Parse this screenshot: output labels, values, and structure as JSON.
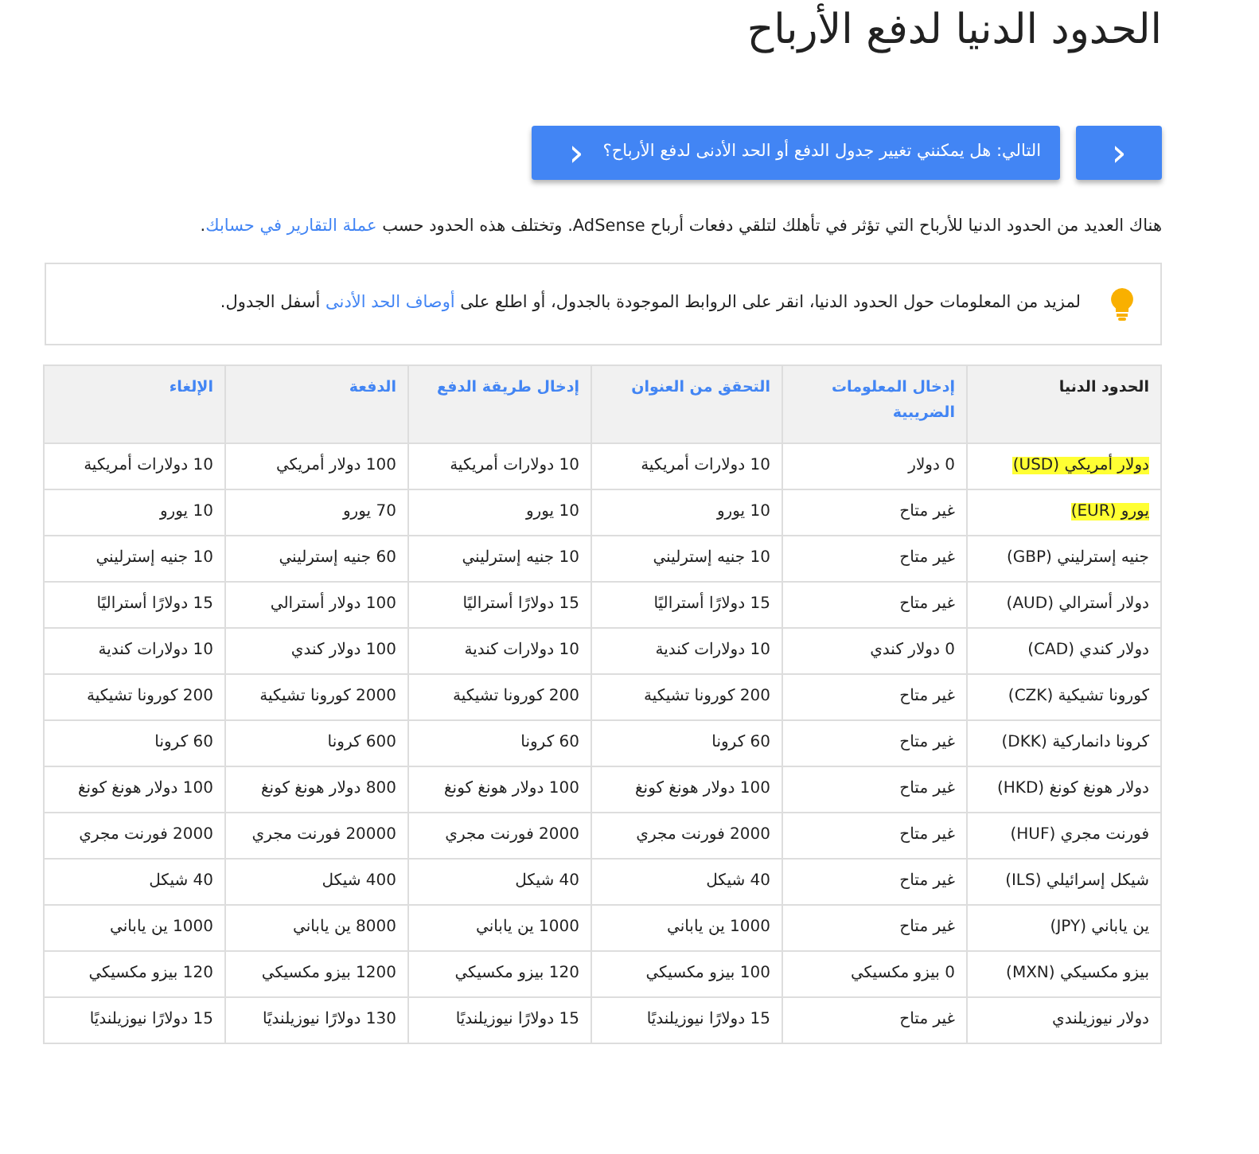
{
  "title": "الحدود الدنيا لدفع الأرباح",
  "nav": {
    "prev_icon": "‹",
    "next_label": "التالي: هل يمكنني تغيير جدول الدفع أو الحد الأدنى لدفع الأرباح؟"
  },
  "intro": [
    {
      "kind": "text",
      "text": "هناك العديد من الحدود الدنيا للأرباح التي تؤثر في تأهلك لتلقي دفعات أرباح AdSense. وتختلف هذه الحدود حسب "
    },
    {
      "kind": "link",
      "text": "عملة التقارير في حسابك"
    },
    {
      "kind": "text",
      "text": "."
    }
  ],
  "callout": [
    {
      "kind": "text",
      "text": "لمزيد من المعلومات حول الحدود الدنيا، انقر على الروابط الموجودة بالجدول، أو اطلع على "
    },
    {
      "kind": "link",
      "text": "أوصاف الحد الأدنى"
    },
    {
      "kind": "text",
      "text": " أسفل الجدول."
    }
  ],
  "table": {
    "columns": [
      {
        "label": "الحدود الدنيا",
        "kind": "plain"
      },
      {
        "label": "إدخال المعلومات الضريبية",
        "kind": "link"
      },
      {
        "label": "التحقق من العنوان",
        "kind": "link"
      },
      {
        "label": "إدخال طريقة الدفع",
        "kind": "link"
      },
      {
        "label": "الدفعة",
        "kind": "link"
      },
      {
        "label": "الإلغاء",
        "kind": "link"
      }
    ],
    "rows": [
      {
        "highlighted": true,
        "cells": [
          "دولار أمريكي (USD)",
          "0 دولار",
          "10 دولارات أمريكية",
          "10 دولارات أمريكية",
          "100 دولار أمريكي",
          "10 دولارات أمريكية"
        ]
      },
      {
        "highlighted": true,
        "cells": [
          "يورو (EUR)",
          "غير متاح",
          "10 يورو",
          "10 يورو",
          "70 يورو",
          "10 يورو"
        ]
      },
      {
        "highlighted": false,
        "cells": [
          "جنيه إسترليني (GBP)",
          "غير متاح",
          "10 جنيه إسترليني",
          "10 جنيه إسترليني",
          "60 جنيه إسترليني",
          "10 جنيه إسترليني"
        ]
      },
      {
        "highlighted": false,
        "cells": [
          "دولار أسترالي (AUD)",
          "غير متاح",
          "15 دولارًا أستراليًا",
          "15 دولارًا أستراليًا",
          "100 دولار أسترالي",
          "15 دولارًا أستراليًا"
        ]
      },
      {
        "highlighted": false,
        "cells": [
          "دولار كندي (CAD)",
          "0 دولار كندي",
          "10 دولارات كندية",
          "10 دولارات كندية",
          "100 دولار كندي",
          "10 دولارات كندية"
        ]
      },
      {
        "highlighted": false,
        "cells": [
          "كورونا تشيكية (CZK)",
          "غير متاح",
          "200 كورونا تشيكية",
          "200 كورونا تشيكية",
          "2000 كورونا تشيكية",
          "200 كورونا تشيكية"
        ]
      },
      {
        "highlighted": false,
        "cells": [
          "كرونا دانماركية (DKK)",
          "غير متاح",
          "60 كرونا",
          "60 كرونا",
          "600 كرونا",
          "60 كرونا"
        ]
      },
      {
        "highlighted": false,
        "cells": [
          "دولار هونغ كونغ (HKD)",
          "غير متاح",
          "100 دولار هونغ كونغ",
          "100 دولار هونغ كونغ",
          "800 دولار هونغ كونغ",
          "100 دولار هونغ كونغ"
        ]
      },
      {
        "highlighted": false,
        "cells": [
          "فورنت مجري (HUF)",
          "غير متاح",
          "2000 فورنت مجري",
          "2000 فورنت مجري",
          "20000 فورنت مجري",
          "2000 فورنت مجري"
        ]
      },
      {
        "highlighted": false,
        "cells": [
          "شيكل إسرائيلي (ILS)",
          "غير متاح",
          "40 شيكل",
          "40 شيكل",
          "400 شيكل",
          "40 شيكل"
        ]
      },
      {
        "highlighted": false,
        "cells": [
          "ين ياباني (JPY)",
          "غير متاح",
          "1000 ين ياباني",
          "1000 ين ياباني",
          "8000 ين ياباني",
          "1000 ين ياباني"
        ]
      },
      {
        "highlighted": false,
        "cells": [
          "بيزو مكسيكي (MXN)",
          "0 بيزو مكسيكي",
          "100 بيزو مكسيكي",
          "120 بيزو مكسيكي",
          "1200 بيزو مكسيكي",
          "120 بيزو مكسيكي"
        ]
      },
      {
        "highlighted": false,
        "cells": [
          "دولار نيوزيلندي",
          "غير متاح",
          "15 دولارًا نيوزيلنديًا",
          "15 دولارًا نيوزيلنديًا",
          "130 دولارًا نيوزيلنديًا",
          "15 دولارًا نيوزيلنديًا"
        ]
      }
    ]
  }
}
